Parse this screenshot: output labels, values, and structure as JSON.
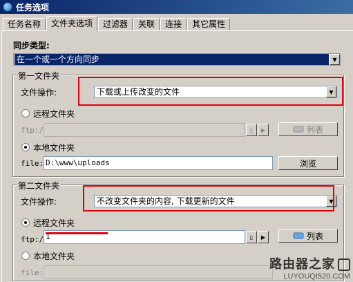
{
  "window": {
    "title": "任务选项"
  },
  "tabs": [
    {
      "label": "任务名称",
      "active": false
    },
    {
      "label": "文件夹选项",
      "active": true
    },
    {
      "label": "过滤器",
      "active": false
    },
    {
      "label": "关联",
      "active": false
    },
    {
      "label": "连接",
      "active": false
    },
    {
      "label": "其它属性",
      "active": false
    }
  ],
  "sync": {
    "label": "同步类型:",
    "value": "在一个或一个方向同步"
  },
  "folder1": {
    "title": "第一文件夹",
    "op_label": "文件操作:",
    "op_value": "下载或上传改变的文件",
    "remote_label": "远程文件夹",
    "remote_checked": false,
    "ftp_prefix": "ftp://",
    "ftp_value": "",
    "list_label": "列表",
    "local_label": "本地文件夹",
    "local_checked": true,
    "file_prefix": "file://",
    "file_value": "D:\\www\\uploads",
    "browse_label": "浏览"
  },
  "folder2": {
    "title": "第二文件夹",
    "op_label": "文件操作:",
    "op_value": "不改变文件夹的内容, 下载更新的文件",
    "remote_label": "远程文件夹",
    "remote_checked": true,
    "ftp_prefix": "ftp://",
    "ftp_value": "1",
    "list_label": "列表",
    "local_label": "本地文件夹",
    "local_checked": false,
    "file_prefix": "file://"
  },
  "watermark": {
    "line1": "路由器之家",
    "line2": "LUYOUQI520.COM"
  },
  "colors": {
    "highlight": "#e0000c",
    "title_bar": "#0a246a",
    "selection": "#0a246a"
  }
}
